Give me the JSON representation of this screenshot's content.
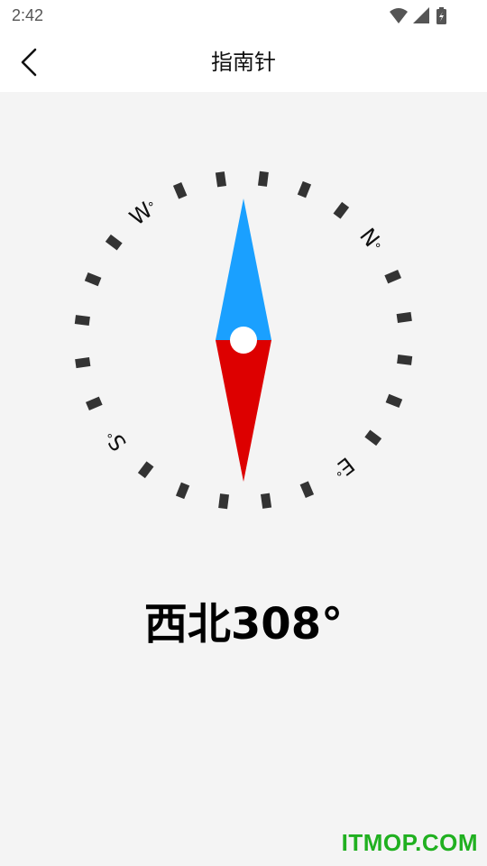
{
  "status_bar": {
    "time": "2:42",
    "icons": [
      "wifi-icon",
      "cell-signal-icon",
      "battery-charging-icon"
    ]
  },
  "app_bar": {
    "back_icon": "chevron-left-icon",
    "title": "指南针"
  },
  "compass": {
    "heading_degrees": 308,
    "labels": {
      "north": "N",
      "east": "E",
      "south": "S",
      "west": "W"
    },
    "degree_mark": "°",
    "needle_north_color": "#1aa0ff",
    "needle_south_color": "#dd0000",
    "tick_color": "#333333"
  },
  "readout": {
    "text": "西北308°"
  },
  "watermark": {
    "text": "ITMOP.COM",
    "color": "#20b020"
  }
}
